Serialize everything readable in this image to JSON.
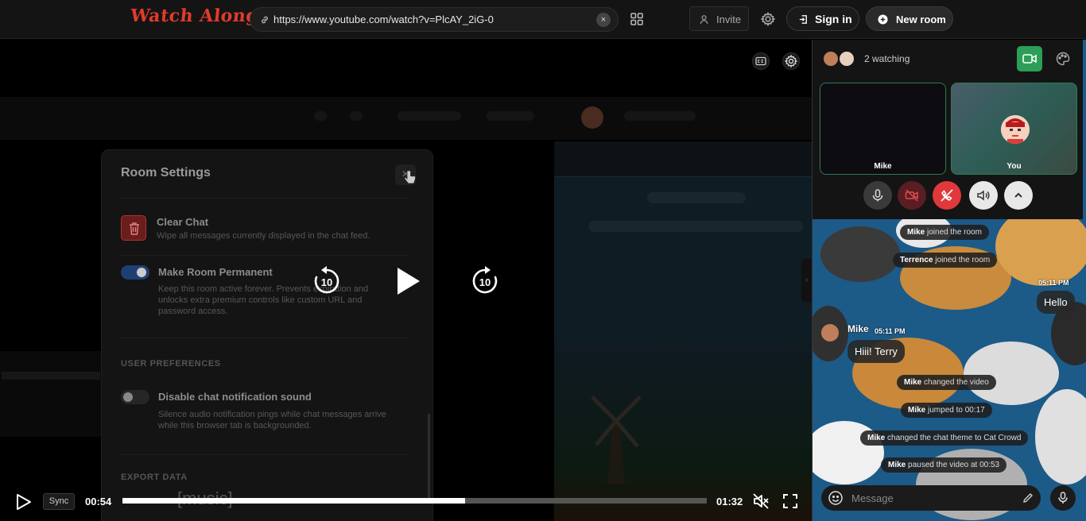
{
  "app": {
    "logo": "Watch Along"
  },
  "topbar": {
    "url": "https://www.youtube.com/watch?v=PlcAY_2iG-0",
    "clear_glyph": "×",
    "invite_label": "Invite",
    "signin_label": "Sign in",
    "new_room_label": "New room"
  },
  "settings": {
    "title": "Room Settings",
    "close_glyph": "×",
    "clear_chat": {
      "title": "Clear Chat",
      "desc": "Wipe all messages currently displayed in the chat feed."
    },
    "permanent": {
      "title": "Make Room Permanent",
      "desc": "Keep this room active forever. Prevents expiration and unlocks extra premium controls like custom URL and password access.",
      "enabled": true
    },
    "user_prefs_label": "USER PREFERENCES",
    "notif": {
      "title": "Disable chat notification sound",
      "desc": "Silence audio notification pings while chat messages arrive while this browser tab is backgrounded.",
      "enabled": false
    },
    "export_label": "EXPORT DATA"
  },
  "player": {
    "skip_back": "10",
    "skip_fwd": "10",
    "caption": "[music]",
    "sync_label": "Sync",
    "current_time": "00:54",
    "total_time": "01:32",
    "progress": 0.587
  },
  "side": {
    "watching": "2 watching",
    "tiles": [
      {
        "name": "Mike"
      },
      {
        "name": "You"
      }
    ],
    "chat_theme": "Cat Crowd",
    "messages": {
      "m1": {
        "user": "Mike",
        "text": "joined the room"
      },
      "m2": {
        "user": "Terrence",
        "text": "joined the room"
      },
      "m3": {
        "time": "05:11 PM",
        "text": "Hello"
      },
      "m4": {
        "sender": "Mike",
        "time": "05:11 PM",
        "text": "Hiii! Terry"
      },
      "m5": {
        "user": "Mike",
        "text": "changed the video"
      },
      "m6": {
        "user": "Mike",
        "text": "jumped to 00:17"
      },
      "m7": {
        "user": "Mike",
        "text": "changed the chat theme to Cat Crowd"
      },
      "m8": {
        "user": "Mike",
        "text": "paused the video at 00:53"
      }
    },
    "message_placeholder": "Message"
  },
  "colors": {
    "brand": "#e23b2b",
    "camera_on": "#2d9e58",
    "end_call": "#e0383b",
    "tile_border": "#2f7a55"
  },
  "icons": [
    "link-icon",
    "apps-grid-icon",
    "user-plus-icon",
    "gear-icon",
    "sign-in-icon",
    "plus-circle-icon",
    "closed-captions-icon",
    "rewind-10-icon",
    "play-icon",
    "forward-10-icon",
    "mute-icon",
    "fullscreen-icon",
    "video-camera-icon",
    "palette-icon",
    "microphone-icon",
    "camera-off-icon",
    "end-call-icon",
    "speaker-icon",
    "chevron-up-icon",
    "emoji-icon",
    "pen-icon",
    "trash-icon"
  ]
}
